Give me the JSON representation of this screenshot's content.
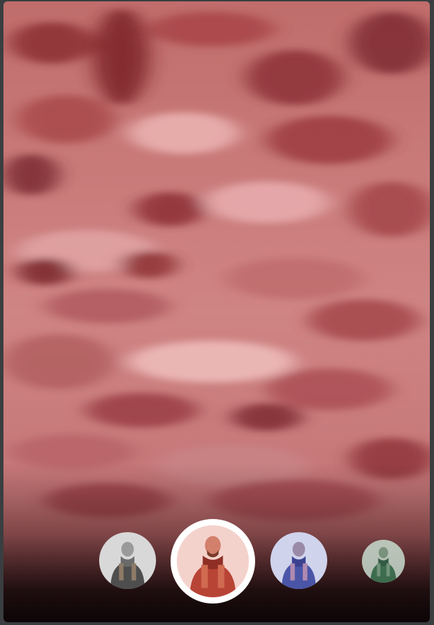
{
  "screen": {
    "background_color": "#3a3e40",
    "preview_tint": "#c77878"
  },
  "filters": {
    "selected_index": 1,
    "items": [
      {
        "id": "mono",
        "tint": "#7d7d7d",
        "icon": "portrait-thumbnail-icon"
      },
      {
        "id": "red",
        "tint": "#c0463c",
        "icon": "portrait-thumbnail-icon"
      },
      {
        "id": "blue",
        "tint": "#5a63b0",
        "icon": "portrait-thumbnail-icon"
      },
      {
        "id": "green",
        "tint": "#4f8a6a",
        "icon": "portrait-thumbnail-icon"
      }
    ]
  }
}
